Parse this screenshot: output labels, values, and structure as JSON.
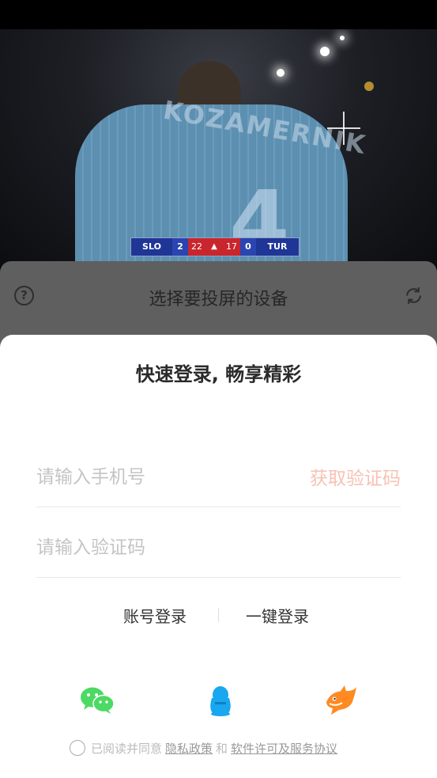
{
  "video": {
    "jersey_name": "KOZAMERNIK",
    "jersey_number": "4",
    "scoreboard": {
      "left_team": "SLO",
      "left_sets": "2",
      "left_points": "22",
      "right_points": "17",
      "right_sets": "0",
      "right_team": "TUR"
    }
  },
  "cast": {
    "title": "选择要投屏的设备",
    "help_icon": "question-circle-icon",
    "refresh_icon": "refresh-icon"
  },
  "login": {
    "title": "快速登录, 畅享精彩",
    "phone_placeholder": "请输入手机号",
    "get_code_label": "获取验证码",
    "code_placeholder": "请输入验证码",
    "account_login_label": "账号登录",
    "onekey_login_label": "一键登录",
    "social": [
      "wechat-icon",
      "qq-icon",
      "shark-icon"
    ],
    "agree_text": "已阅读并同意",
    "privacy_link": "隐私政策",
    "and_text": "和",
    "license_link": "软件许可及服务协议"
  },
  "colors": {
    "accent": "#f7c2b3",
    "wechat": "#4cd964",
    "qq": "#19a7ef",
    "shark": "#ff8a22"
  }
}
